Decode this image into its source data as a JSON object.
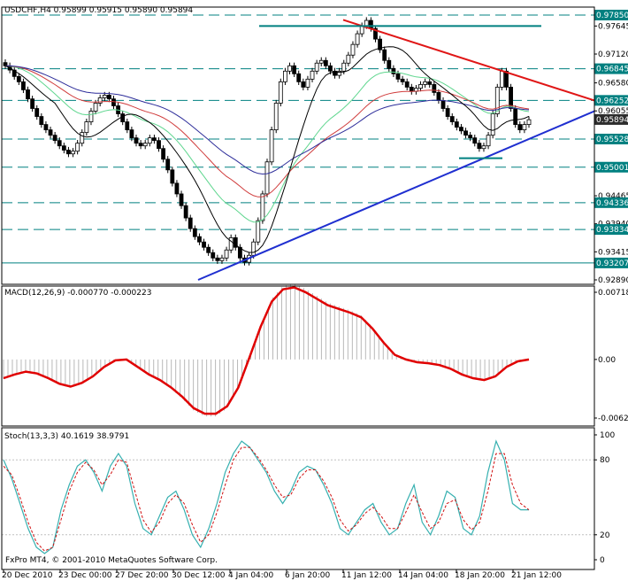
{
  "chart_data": [
    {
      "type": "candlestick",
      "panel": "price",
      "title": "USDCHF,H4  0.95899 0.95915 0.95890 0.95894",
      "ylim": [
        0.9289,
        0.979
      ],
      "y_ticks": [
        "0.97645",
        "0.97120",
        "0.96580",
        "0.96055",
        "0.95528",
        "0.95001",
        "0.94465",
        "0.93940",
        "0.93415",
        "0.92890"
      ],
      "levels": [
        {
          "label": "0.97850",
          "value": 0.9785
        },
        {
          "label": "0.96845",
          "value": 0.96845
        },
        {
          "label": "0.96252",
          "value": 0.96252
        },
        {
          "label": "0.95528",
          "value": 0.95528
        },
        {
          "label": "0.95001",
          "value": 0.95001
        },
        {
          "label": "0.94336",
          "value": 0.94336
        },
        {
          "label": "0.93834",
          "value": 0.93834
        },
        {
          "label": "0.93207",
          "value": 0.93207
        }
      ],
      "current": {
        "label": "0.95894",
        "value": 0.95894
      },
      "close_series": [
        0.969,
        0.9682,
        0.967,
        0.966,
        0.9645,
        0.9628,
        0.961,
        0.9595,
        0.958,
        0.957,
        0.956,
        0.955,
        0.954,
        0.9532,
        0.9525,
        0.953,
        0.9545,
        0.9565,
        0.9585,
        0.9605,
        0.962,
        0.963,
        0.9635,
        0.9628,
        0.9615,
        0.96,
        0.9585,
        0.957,
        0.9555,
        0.9545,
        0.954,
        0.9545,
        0.9555,
        0.955,
        0.9535,
        0.9515,
        0.9495,
        0.947,
        0.945,
        0.9428,
        0.9405,
        0.9385,
        0.937,
        0.936,
        0.935,
        0.934,
        0.933,
        0.9325,
        0.933,
        0.9345,
        0.9368,
        0.935,
        0.933,
        0.9322,
        0.9335,
        0.936,
        0.94,
        0.945,
        0.951,
        0.957,
        0.962,
        0.966,
        0.968,
        0.969,
        0.9675,
        0.966,
        0.965,
        0.9665,
        0.968,
        0.9695,
        0.97,
        0.969,
        0.968,
        0.9672,
        0.968,
        0.9695,
        0.971,
        0.973,
        0.975,
        0.9765,
        0.9775,
        0.976,
        0.974,
        0.972,
        0.97,
        0.9685,
        0.9675,
        0.9665,
        0.966,
        0.965,
        0.9642,
        0.9648,
        0.9655,
        0.966,
        0.9655,
        0.964,
        0.9625,
        0.961,
        0.9595,
        0.9585,
        0.9575,
        0.9568,
        0.956,
        0.9555,
        0.9545,
        0.9535,
        0.954,
        0.956,
        0.96,
        0.965,
        0.968,
        0.965,
        0.961,
        0.958,
        0.957,
        0.958,
        0.9589
      ]
    },
    {
      "type": "line",
      "panel": "macd",
      "title": "MACD(12,26,9) -0.000770 -0.000223",
      "ylim": [
        -0.00626,
        0.00718
      ],
      "y_ticks": [
        "0.00718",
        "0.00",
        "-0.00626"
      ],
      "signal_series": [
        -0.002,
        -0.0016,
        -0.0013,
        -0.0015,
        -0.002,
        -0.0026,
        -0.0029,
        -0.0025,
        -0.0018,
        -0.0008,
        -0.0001,
        0.0,
        -0.0008,
        -0.0016,
        -0.0022,
        -0.003,
        -0.004,
        -0.0052,
        -0.0058,
        -0.0058,
        -0.005,
        -0.003,
        0.0002,
        0.0035,
        0.0062,
        0.0075,
        0.0077,
        0.0072,
        0.0065,
        0.0058,
        0.0054,
        0.005,
        0.0045,
        0.0033,
        0.0018,
        0.0005,
        0.0,
        -0.0003,
        -0.0004,
        -0.0006,
        -0.001,
        -0.0016,
        -0.002,
        -0.0022,
        -0.0018,
        -0.0008,
        -0.0002,
        0.0
      ]
    },
    {
      "type": "line",
      "panel": "stochastic",
      "title": "Stoch(13,3,3) 40.1619 38.9791",
      "ylim": [
        0,
        100
      ],
      "y_ticks": [
        "100",
        "80",
        "20",
        "0"
      ],
      "main_series": [
        80,
        65,
        45,
        25,
        10,
        5,
        10,
        40,
        60,
        75,
        80,
        70,
        55,
        75,
        85,
        75,
        45,
        25,
        20,
        35,
        50,
        55,
        40,
        20,
        10,
        25,
        45,
        70,
        85,
        95,
        90,
        80,
        70,
        55,
        45,
        55,
        70,
        75,
        72,
        60,
        45,
        25,
        20,
        30,
        40,
        45,
        30,
        20,
        25,
        45,
        60,
        30,
        20,
        35,
        55,
        50,
        25,
        20,
        35,
        70,
        95,
        80,
        45,
        40,
        40
      ],
      "signal_series": [
        75,
        68,
        50,
        30,
        14,
        7,
        10,
        32,
        55,
        70,
        78,
        72,
        60,
        68,
        80,
        78,
        55,
        32,
        22,
        30,
        45,
        52,
        45,
        28,
        14,
        20,
        38,
        60,
        80,
        90,
        90,
        82,
        72,
        60,
        50,
        52,
        65,
        72,
        72,
        63,
        50,
        32,
        23,
        28,
        37,
        42,
        35,
        25,
        25,
        38,
        52,
        38,
        25,
        30,
        45,
        48,
        32,
        24,
        30,
        55,
        85,
        85,
        60,
        45,
        40
      ],
      "levels": [
        "80",
        "20"
      ]
    }
  ],
  "x_labels": [
    "20 Dec 2010",
    "23 Dec 00:00",
    "27 Dec 20:00",
    "30 Dec 12:00",
    "4 Jan 04:00",
    "6 Jan 20:00",
    "11 Jan 12:00",
    "14 Jan 04:00",
    "18 Jan 20:00",
    "21 Jan 12:00"
  ],
  "footer": "FxPro MT4, © 2001-2010 MetaQuotes Software Corp.",
  "colors": {
    "ma_green": "#5ed68e",
    "ma_red": "#d03c3c",
    "ma_navy": "#2d2d9a",
    "ma_black": "#000000",
    "trend_red": "#e01616",
    "trend_blue": "#1f2fd0",
    "level_teal": "#008080",
    "macd_signal": "#e00000",
    "macd_hist": "#b8b8b8",
    "stoch_main": "#36b0b0",
    "stoch_signal": "#d01010",
    "current_box": "#2d2d2d"
  }
}
